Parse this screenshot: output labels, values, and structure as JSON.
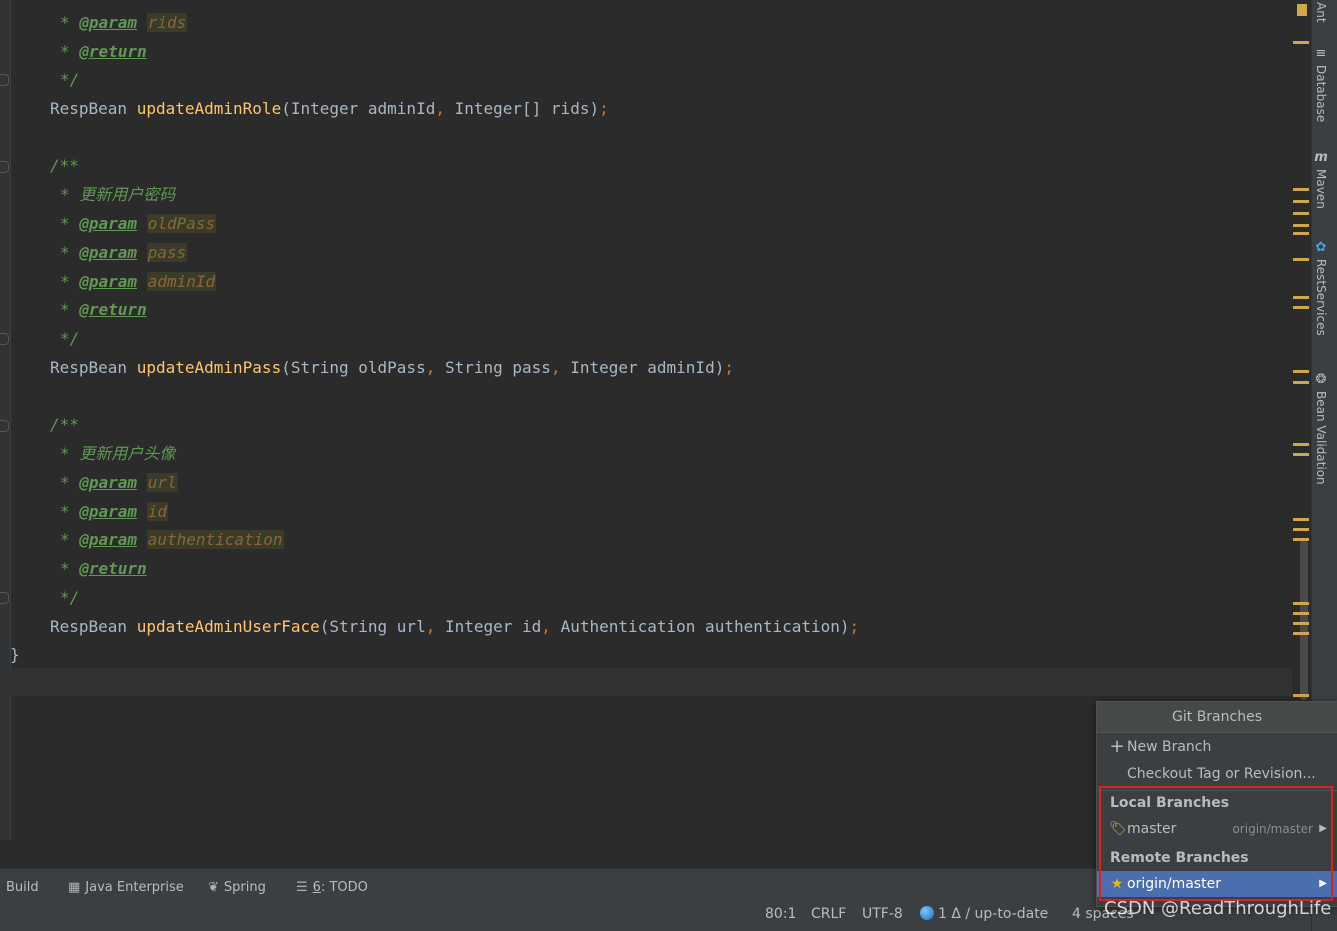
{
  "editor": {
    "lines": {
      "l01_tag": "@param",
      "l01_pn": "rids",
      "l02_tag": "@return",
      "l03": "*/",
      "m1_ret": "RespBean ",
      "m1_name": "updateAdminRole",
      "m1_a": "(Integer adminId",
      "m1_b": ", ",
      "m1_c": "Integer[] rids)",
      "m1_d": ";",
      "d2_open": "/**",
      "d2_desc": "更新用户密码",
      "d2_p1": "oldPass",
      "d2_p2": "pass",
      "d2_p3": "adminId",
      "m2_ret": "RespBean ",
      "m2_name": "updateAdminPass",
      "m2_a": "(String oldPass",
      "m2_b": "String pass",
      "m2_c": "Integer adminId)",
      "d3_open": "/**",
      "d3_desc": "更新用户头像",
      "d3_p1": "url",
      "d3_p2": "id",
      "d3_p3": "authentication",
      "m3_ret": "RespBean ",
      "m3_name": "updateAdminUserFace",
      "m3_a": "(String url",
      "m3_b": "Integer id",
      "m3_c": "Authentication authentication)",
      "close_brace": "}",
      "param": "@param",
      "return": "@return",
      "star": "* ",
      "end": "*/",
      "comma": ", ",
      "semi": ";"
    }
  },
  "right_tools": [
    {
      "label": "Ant",
      "icon": "ant-icon"
    },
    {
      "label": "Database",
      "icon": "database-icon"
    },
    {
      "label": "Maven",
      "icon": "maven-icon"
    },
    {
      "label": "RestServices",
      "icon": "rest-services-icon"
    },
    {
      "label": "Bean Validation",
      "icon": "bean-validation-icon"
    }
  ],
  "toolbar": {
    "build": "Build",
    "java_enterprise": "Java Enterprise",
    "spring": "Spring",
    "todo_num": "6",
    "todo": ": TODO"
  },
  "status": {
    "position": "80:1",
    "line_sep": "CRLF",
    "encoding": "UTF-8",
    "vcs": "1 Δ / up-to-date",
    "indent": "4 spaces"
  },
  "git_popup": {
    "title": "Git Branches",
    "new_branch": "New Branch",
    "checkout": "Checkout Tag or Revision...",
    "local_header": "Local Branches",
    "local_branch": "master",
    "local_tracking": "origin/master",
    "remote_header": "Remote Branches",
    "remote_branch": "origin/master"
  },
  "watermark": "CSDN @ReadThroughLife",
  "colors": {
    "accent": "#4b6eaf",
    "highlight_box": "#e0201f",
    "method": "#ffc66d",
    "doc_comment": "#629755"
  }
}
